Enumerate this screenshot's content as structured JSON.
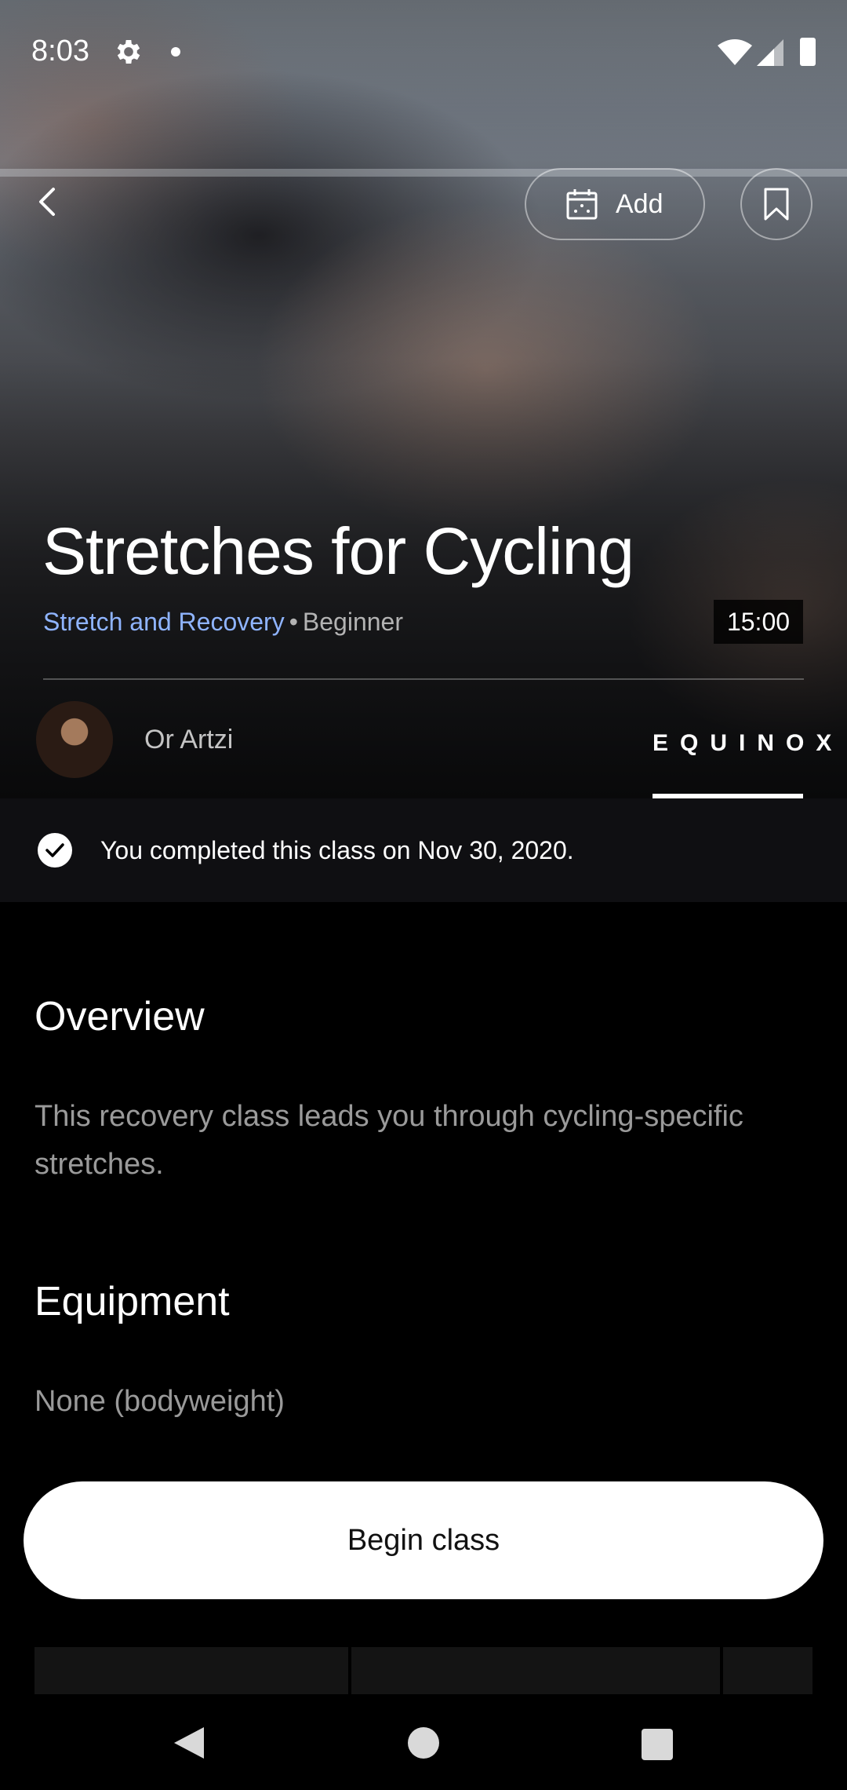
{
  "status_bar": {
    "time": "8:03",
    "icons": [
      "gear-icon",
      "notification-dot-icon",
      "wifi-icon",
      "signal-icon",
      "battery-icon"
    ]
  },
  "header": {
    "back_icon": "chevron-left-icon",
    "add_label": "Add",
    "add_icon": "calendar-icon",
    "bookmark_icon": "bookmark-icon"
  },
  "class": {
    "title": "Stretches for Cycling",
    "category": "Stretch and Recovery",
    "separator": "•",
    "level": "Beginner",
    "duration": "15:00",
    "instructor": "Or Artzi",
    "brand": "EQUINOX"
  },
  "completion": {
    "text": "You completed this class on Nov 30, 2020."
  },
  "overview": {
    "heading": "Overview",
    "text": "This recovery class leads you through cycling-specific stretches."
  },
  "equipment": {
    "heading": "Equipment",
    "text": "None (bodyweight)"
  },
  "actions": {
    "begin_label": "Begin class"
  },
  "colors": {
    "accent_link": "#8fb4ff",
    "background": "#000000",
    "banner": "#0f0f12"
  }
}
